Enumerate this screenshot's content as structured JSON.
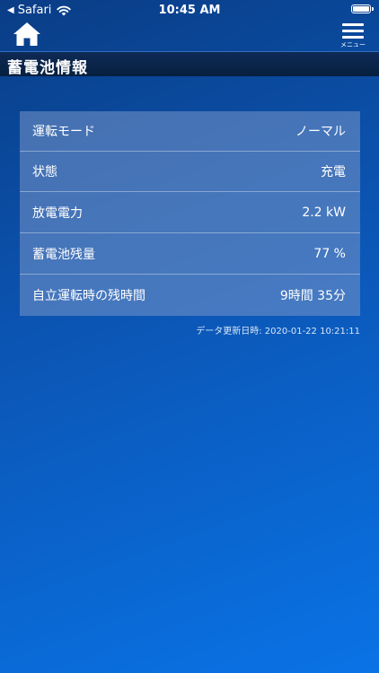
{
  "status_bar": {
    "back_app": "Safari",
    "time": "10:45 AM"
  },
  "nav": {
    "menu_label": "メニュー"
  },
  "page": {
    "title": "蓄電池情報"
  },
  "info_rows": [
    {
      "label": "運転モード",
      "value": "ノーマル"
    },
    {
      "label": "状態",
      "value": "充電"
    },
    {
      "label": "放電電力",
      "value": "2.2 kW"
    },
    {
      "label": "蓄電池残量",
      "value": "77 %"
    },
    {
      "label": "自立運転時の残時間",
      "value": "9時間 35分"
    }
  ],
  "updated": {
    "label": "データ更新日時:",
    "value": "2020-01-22 10:21:11"
  },
  "colors": {
    "background_top": "#0a3d86",
    "background_bottom": "#0a73e6",
    "title_bar": "#0e2a55",
    "table_bg": "#7896c8"
  },
  "icons": {
    "home": "home-icon",
    "menu": "hamburger-menu-icon",
    "wifi": "wifi-icon",
    "battery": "battery-icon"
  }
}
